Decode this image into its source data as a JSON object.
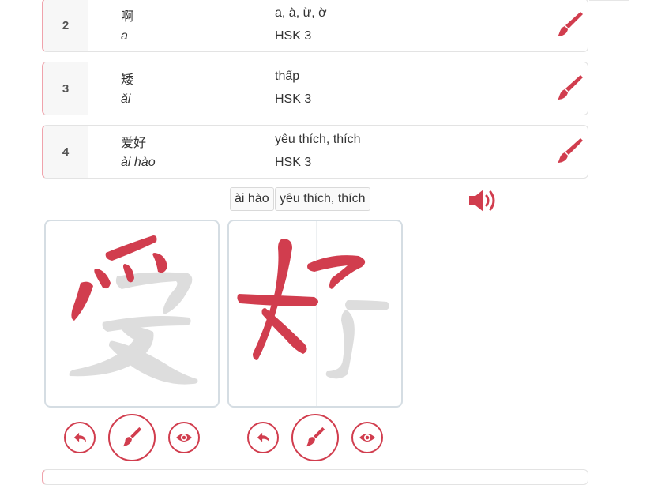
{
  "accent_color": "#d13d4e",
  "guide_color": "#dddddd",
  "words": [
    {
      "index": "2",
      "hanzi": "啊",
      "pinyin": "a",
      "meaning": "a, à, ừ, ờ",
      "level": "HSK 3"
    },
    {
      "index": "3",
      "hanzi": "矮",
      "pinyin": "ǎi",
      "meaning": "thấp",
      "level": "HSK 3"
    },
    {
      "index": "4",
      "hanzi": "爱好",
      "pinyin": "ài hào",
      "meaning": "yêu thích, thích",
      "level": "HSK 3"
    }
  ],
  "selected": {
    "pinyin": "ài hào",
    "meaning": "yêu thích, thích"
  },
  "practice": [
    {
      "char": "爱",
      "controls": [
        "undo-icon",
        "brush-icon",
        "eye-icon"
      ]
    },
    {
      "char": "好",
      "controls": [
        "undo-icon",
        "brush-icon",
        "eye-icon"
      ]
    }
  ]
}
